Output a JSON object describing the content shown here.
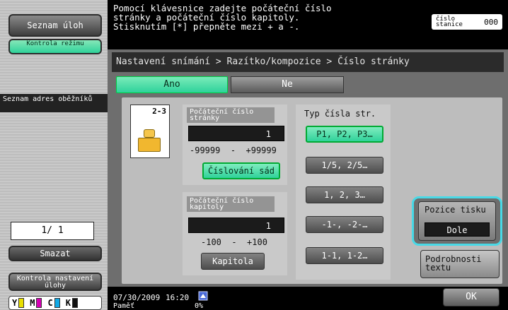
{
  "left": {
    "job_list": "Seznam úloh",
    "mode_check": "Kontrola režimu",
    "address_book": "Seznam adres oběžníků",
    "counter": "1/ 1",
    "delete": "Smazat",
    "job_settings_check": "Kontrola nastavení úlohy",
    "toners": [
      {
        "label": "Y",
        "color": "#e9df00"
      },
      {
        "label": "M",
        "color": "#d400b4"
      },
      {
        "label": "C",
        "color": "#12a9e6"
      },
      {
        "label": "K",
        "color": "#111111"
      }
    ]
  },
  "message": {
    "line1": "Pomocí klávesnice zadejte počáteční číslo",
    "line2": "stránky a počáteční číslo kapitoly.",
    "line3": "Stisknutím [*] přepněte mezi + a -.",
    "station_label": "číslo stanice",
    "station_value": "000"
  },
  "main": {
    "breadcrumb": "Nastavení snímání > Razítko/kompozice > Číslo stránky",
    "yes": "Ano",
    "no": "Ne",
    "page_num": "2-3",
    "start_page": {
      "title": "Počáteční číslo stránky",
      "value": "1",
      "range_min": "-99999",
      "range_sep": "-",
      "range_max": "+99999",
      "button": "Číslování sád"
    },
    "start_chapter": {
      "title": "Počáteční číslo kapitoly",
      "value": "1",
      "range_min": "-100",
      "range_sep": "-",
      "range_max": "+100",
      "button": "Kapitola"
    },
    "type": {
      "title": "Typ čísla str.",
      "options": [
        "P1, P2, P3…",
        "1/5, 2/5…",
        "1, 2, 3…",
        "-1-, -2-…",
        "1-1, 1-2…"
      ],
      "selected_index": 0
    },
    "print_position": {
      "label": "Pozice tisku",
      "value": "Dole"
    },
    "text_details": "Podrobnosti textu"
  },
  "bottom": {
    "date": "07/30/2009",
    "time": "16:20",
    "memory": "Paměť",
    "percent": "0%",
    "ok": "OK"
  }
}
